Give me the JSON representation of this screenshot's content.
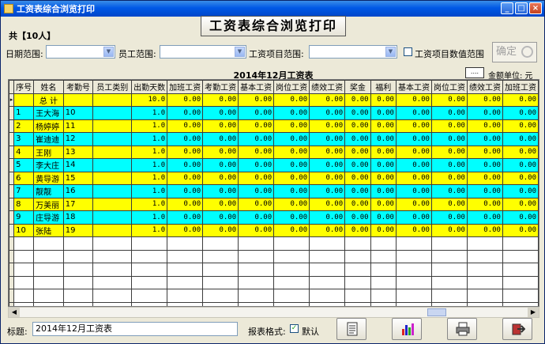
{
  "window": {
    "title": "工资表综合浏览打印"
  },
  "count_label": "共【10人】",
  "main_button": "工资表综合浏览打印",
  "filters": {
    "date_label": "日期范围:",
    "employee_label": "员工范围:",
    "item_label": "工资项目范围:",
    "numeric_range_label": "工资项目数值范围",
    "ok_label": "确定"
  },
  "table": {
    "title": "2014年12月工资表",
    "unit_button": "....",
    "unit_label": "金额单位: 元",
    "columns": [
      "序号",
      "姓名",
      "考勤号",
      "员工类别",
      "出勤天数",
      "加班工资",
      "考勤工资",
      "基本工资",
      "岗位工资",
      "绩效工资",
      "奖金",
      "福利",
      "基本工资",
      "岗位工资",
      "绩效工资",
      "加班工资"
    ],
    "total_row": {
      "seq": "",
      "name": "总 计",
      "att_no": "",
      "category": "",
      "values": [
        "10.0",
        "0.00",
        "0.00",
        "0.00",
        "0.00",
        "0.00",
        "0.00",
        "0.00",
        "0.00",
        "0.00",
        "0.00",
        "0.00"
      ]
    },
    "rows": [
      {
        "seq": "1",
        "name": "王大海",
        "att_no": "10",
        "category": "",
        "values": [
          "1.0",
          "0.00",
          "0.00",
          "0.00",
          "0.00",
          "0.00",
          "0.00",
          "0.00",
          "0.00",
          "0.00",
          "0.00",
          "0.00"
        ]
      },
      {
        "seq": "2",
        "name": "杨婷婷",
        "att_no": "11",
        "category": "",
        "values": [
          "1.0",
          "0.00",
          "0.00",
          "0.00",
          "0.00",
          "0.00",
          "0.00",
          "0.00",
          "0.00",
          "0.00",
          "0.00",
          "0.00"
        ]
      },
      {
        "seq": "3",
        "name": "崔迪迪",
        "att_no": "12",
        "category": "",
        "values": [
          "1.0",
          "0.00",
          "0.00",
          "0.00",
          "0.00",
          "0.00",
          "0.00",
          "0.00",
          "0.00",
          "0.00",
          "0.00",
          "0.00"
        ]
      },
      {
        "seq": "4",
        "name": "王刚",
        "att_no": "13",
        "category": "",
        "values": [
          "1.0",
          "0.00",
          "0.00",
          "0.00",
          "0.00",
          "0.00",
          "0.00",
          "0.00",
          "0.00",
          "0.00",
          "0.00",
          "0.00"
        ]
      },
      {
        "seq": "5",
        "name": "李大庄",
        "att_no": "14",
        "category": "",
        "values": [
          "1.0",
          "0.00",
          "0.00",
          "0.00",
          "0.00",
          "0.00",
          "0.00",
          "0.00",
          "0.00",
          "0.00",
          "0.00",
          "0.00"
        ]
      },
      {
        "seq": "6",
        "name": "黄导游",
        "att_no": "15",
        "category": "",
        "values": [
          "1.0",
          "0.00",
          "0.00",
          "0.00",
          "0.00",
          "0.00",
          "0.00",
          "0.00",
          "0.00",
          "0.00",
          "0.00",
          "0.00"
        ]
      },
      {
        "seq": "7",
        "name": "靓靓",
        "att_no": "16",
        "category": "",
        "values": [
          "1.0",
          "0.00",
          "0.00",
          "0.00",
          "0.00",
          "0.00",
          "0.00",
          "0.00",
          "0.00",
          "0.00",
          "0.00",
          "0.00"
        ]
      },
      {
        "seq": "8",
        "name": "万美丽",
        "att_no": "17",
        "category": "",
        "values": [
          "1.0",
          "0.00",
          "0.00",
          "0.00",
          "0.00",
          "0.00",
          "0.00",
          "0.00",
          "0.00",
          "0.00",
          "0.00",
          "0.00"
        ]
      },
      {
        "seq": "9",
        "name": "庄导游",
        "att_no": "18",
        "category": "",
        "values": [
          "1.0",
          "0.00",
          "0.00",
          "0.00",
          "0.00",
          "0.00",
          "0.00",
          "0.00",
          "0.00",
          "0.00",
          "0.00",
          "0.00"
        ]
      },
      {
        "seq": "10",
        "name": "张陆",
        "att_no": "19",
        "category": "",
        "values": [
          "1.0",
          "0.00",
          "0.00",
          "0.00",
          "0.00",
          "0.00",
          "0.00",
          "0.00",
          "0.00",
          "0.00",
          "0.00",
          "0.00"
        ]
      }
    ],
    "empty_rows": 6,
    "colors": {
      "yellow": "#ffff00",
      "cyan": "#00ffff"
    }
  },
  "bottom": {
    "title_label": "标题:",
    "title_value": "2014年12月工资表",
    "format_label": "报表格式:",
    "default_label": "默认",
    "icons": [
      "report-icon",
      "chart-icon",
      "printer-icon",
      "exit-icon"
    ]
  }
}
